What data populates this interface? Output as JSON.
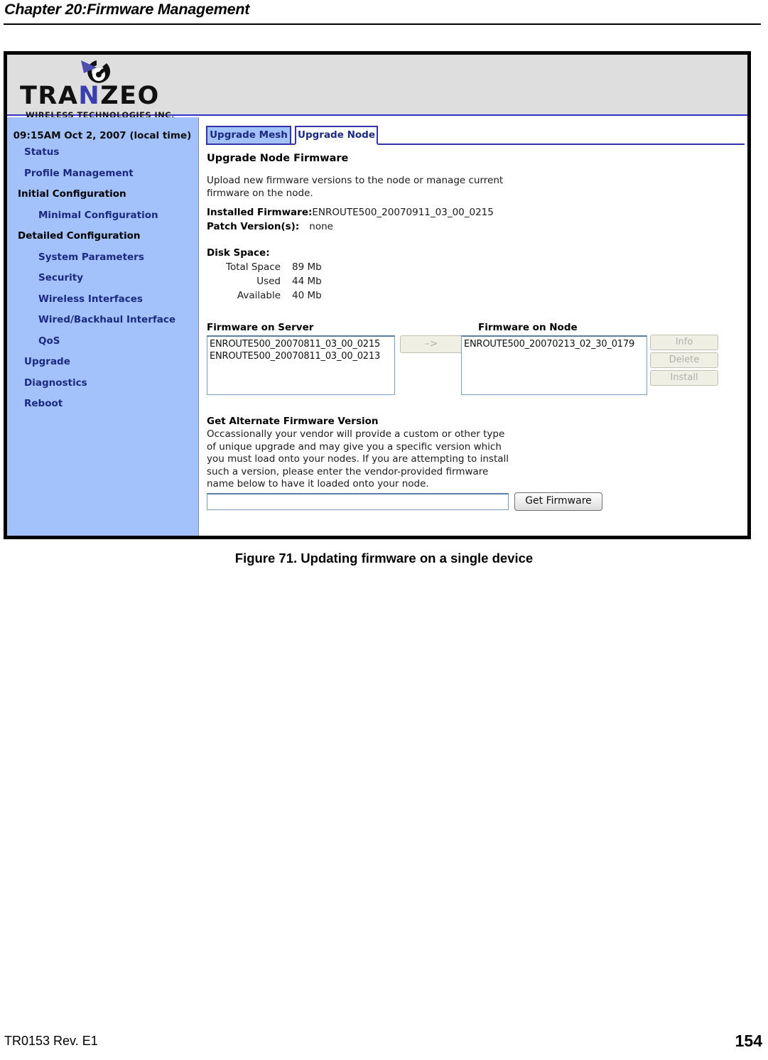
{
  "document": {
    "chapter_title": "Chapter 20:Firmware Management",
    "figure_caption": "Figure 71. Updating firmware on a single device",
    "footer_left": "TR0153 Rev. E1",
    "footer_right": "154"
  },
  "branding": {
    "wordmark_pre": "TRA",
    "wordmark_n": "N",
    "wordmark_post": "ZEO",
    "tagline": "WIRELESS  TECHNOLOGIES INC.",
    "dish_icon": "satellite-dish-icon",
    "accent_blue": "#3b3fae",
    "banner_bg": "#dedede"
  },
  "sidebar": {
    "clock": "09:15AM Oct 2, 2007 (local time)",
    "bg_color": "#a3c2fc",
    "link_color": "#1b2a80",
    "items": [
      {
        "label": "Status",
        "level": "lvl0",
        "type": "link"
      },
      {
        "label": "Profile Management",
        "level": "lvl0",
        "type": "link"
      },
      {
        "label": "Initial Configuration",
        "level": "lvl-head",
        "type": "heading"
      },
      {
        "label": "Minimal Configuration",
        "level": "lvl1",
        "type": "link"
      },
      {
        "label": "Detailed Configuration",
        "level": "lvl-head",
        "type": "heading"
      },
      {
        "label": "System Parameters",
        "level": "lvl1",
        "type": "link"
      },
      {
        "label": "Security",
        "level": "lvl1",
        "type": "link"
      },
      {
        "label": "Wireless Interfaces",
        "level": "lvl1",
        "type": "link"
      },
      {
        "label": "Wired/Backhaul Interface",
        "level": "lvl1",
        "type": "link"
      },
      {
        "label": "QoS",
        "level": "lvl1",
        "type": "link"
      },
      {
        "label": "Upgrade",
        "level": "lvl0",
        "type": "link"
      },
      {
        "label": "Diagnostics",
        "level": "lvl0",
        "type": "link"
      },
      {
        "label": "Reboot",
        "level": "lvl0",
        "type": "link"
      }
    ]
  },
  "tabs": [
    {
      "label": "Upgrade Mesh",
      "active": false
    },
    {
      "label": "Upgrade Node",
      "active": true
    }
  ],
  "main": {
    "heading": "Upgrade Node Firmware",
    "description": "Upload new firmware versions to the node or manage current firmware on the node.",
    "installed_firmware_label": "Installed Firmware:",
    "installed_firmware_value": "ENROUTE500_20070911_03_00_0215",
    "patch_versions_label": "Patch Version(s):",
    "patch_versions_value": "none",
    "disk_space": {
      "title": "Disk Space:",
      "rows": [
        {
          "key": "Total Space",
          "value": "89 Mb"
        },
        {
          "key": "Used",
          "value": "44 Mb"
        },
        {
          "key": "Available",
          "value": "40 Mb"
        }
      ]
    },
    "server_list": {
      "label": "Firmware on Server",
      "options": [
        "ENROUTE500_20070811_03_00_0215",
        "ENROUTE500_20070811_03_00_0213"
      ]
    },
    "node_list": {
      "label": "Firmware on Node",
      "options": [
        "ENROUTE500_20070213_02_30_0179"
      ]
    },
    "transfer_button": "–>",
    "node_buttons": [
      {
        "label": "Info",
        "disabled": true
      },
      {
        "label": "Delete",
        "disabled": true
      },
      {
        "label": "Install",
        "disabled": true
      }
    ],
    "alternate": {
      "title": "Get Alternate Firmware Version",
      "description": "Occassionally your vendor will provide a custom or other type of unique upgrade and may give you a specific version which you must load onto your nodes. If you are attempting to install such a version, please enter the vendor-provided firmware name below to have it loaded onto your node.",
      "input_value": "",
      "input_placeholder": "",
      "button_label": "Get Firmware"
    }
  }
}
